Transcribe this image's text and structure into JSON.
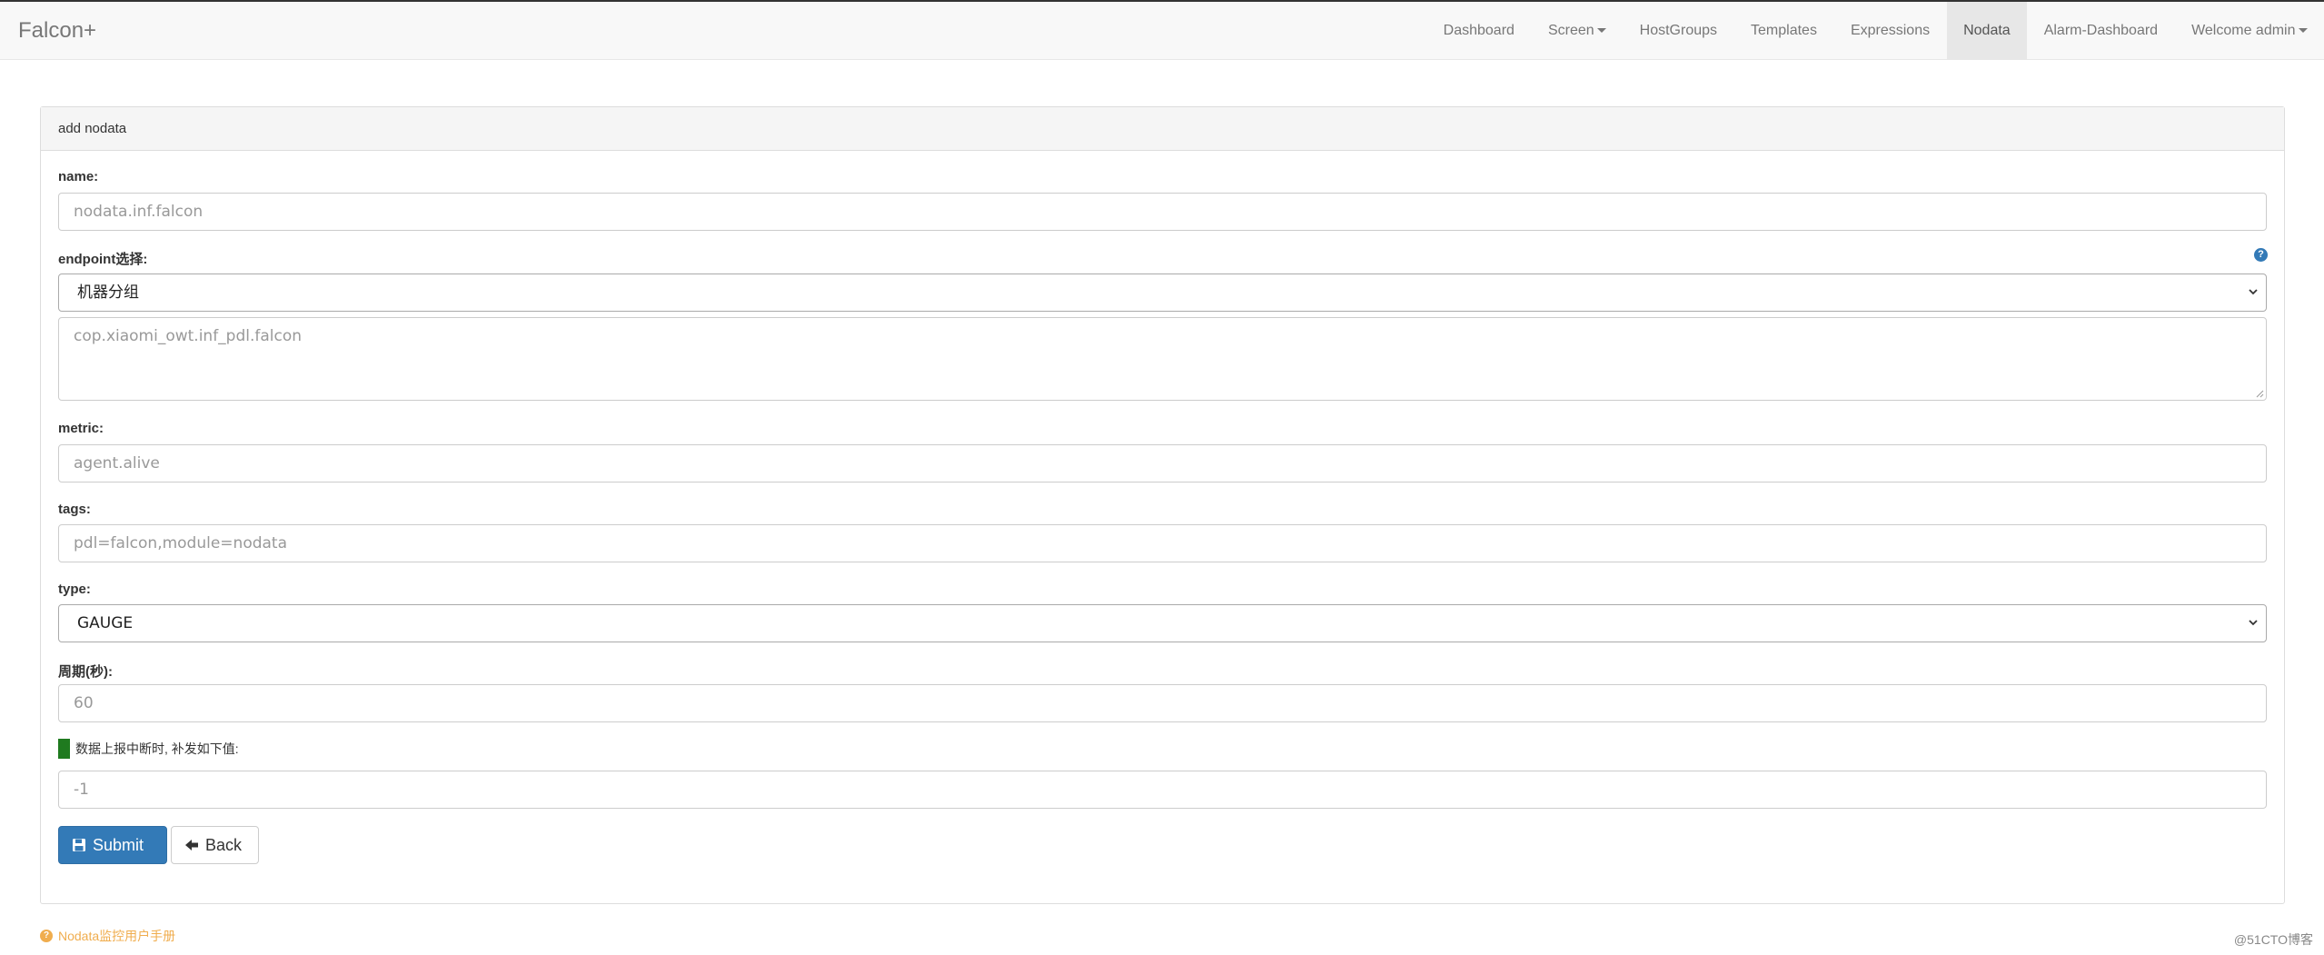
{
  "navbar": {
    "brand": "Falcon+",
    "items": [
      {
        "label": "Dashboard"
      },
      {
        "label": "Screen"
      },
      {
        "label": "HostGroups"
      },
      {
        "label": "Templates"
      },
      {
        "label": "Expressions"
      },
      {
        "label": "Nodata",
        "active": true
      },
      {
        "label": "Alarm-Dashboard"
      },
      {
        "label": "Welcome admin"
      }
    ]
  },
  "panel": {
    "title": "add nodata",
    "name": {
      "label": "name:",
      "placeholder": "nodata.inf.falcon"
    },
    "endpoint": {
      "label": "endpoint选择:",
      "selected": "机器分组",
      "textarea_placeholder": "cop.xiaomi_owt.inf_pdl.falcon"
    },
    "metric": {
      "label": "metric:",
      "placeholder": "agent.alive"
    },
    "tags": {
      "label": "tags:",
      "placeholder": "pdl=falcon,module=nodata"
    },
    "type": {
      "label": "type:",
      "selected": "GAUGE"
    },
    "period": {
      "label": "周期(秒):",
      "placeholder": "60"
    },
    "fill": {
      "checkbox_label": "数据上报中断时, 补发如下值:",
      "placeholder": "-1"
    },
    "submit_label": "Submit",
    "back_label": "Back"
  },
  "footer": {
    "manual_link": "Nodata监控用户手册",
    "watermark": "@51CTO博客"
  },
  "colors": {
    "primary": "#337ab7",
    "warning": "#f0ad4e",
    "checkbox": "#1f7a1f"
  }
}
